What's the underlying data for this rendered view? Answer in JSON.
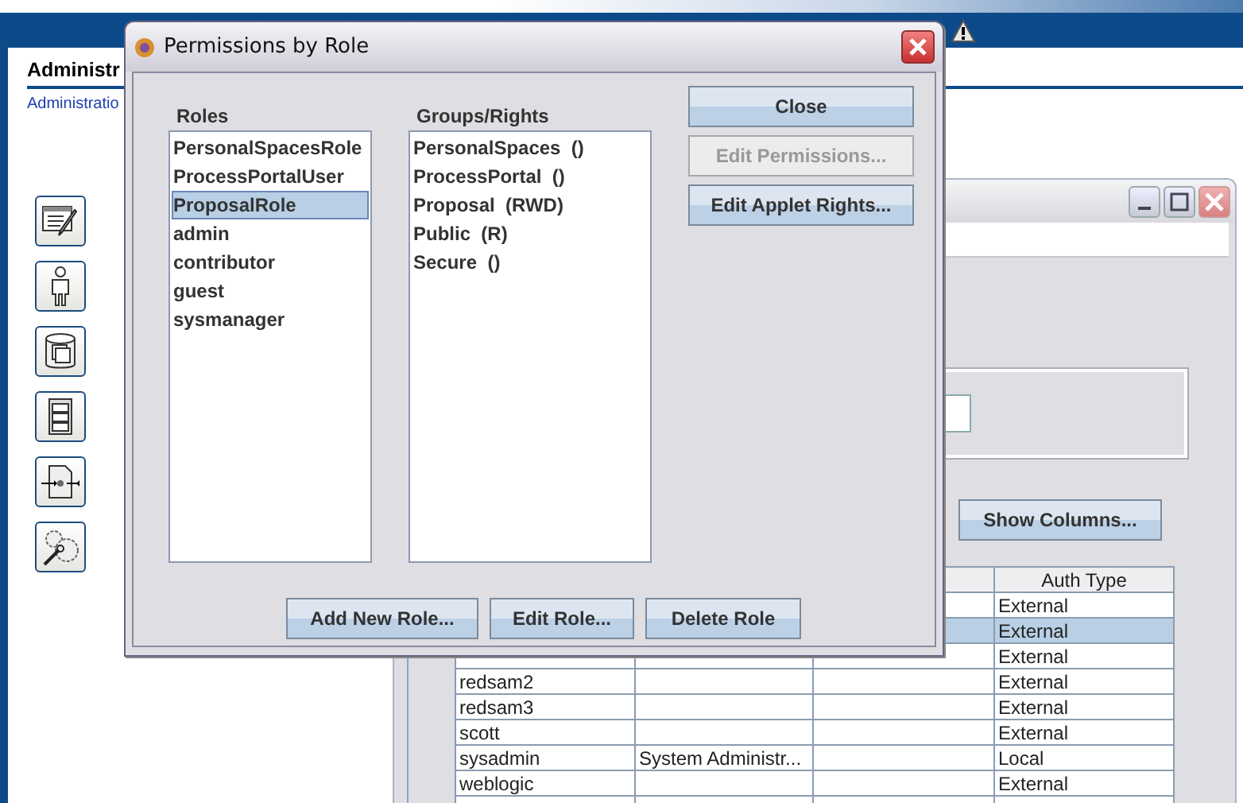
{
  "admin_panel": {
    "heading": "Administr",
    "link": "Administratio"
  },
  "inner_window": {
    "show_columns_button": "Show Columns...",
    "table": {
      "columns": [
        "",
        "",
        "",
        "Auth Type"
      ],
      "rows": [
        {
          "auth_type": "External",
          "selected": false
        },
        {
          "auth_type": "External",
          "selected": true
        },
        {
          "auth_type": "External",
          "selected": false
        },
        {
          "user": "redsam2",
          "auth_type": "External",
          "selected": false
        },
        {
          "user": "redsam3",
          "auth_type": "External",
          "selected": false
        },
        {
          "user": "scott",
          "auth_type": "External",
          "selected": false
        },
        {
          "user": "sysadmin",
          "description": "System Administr...",
          "auth_type": "Local",
          "selected": false
        },
        {
          "user": "weblogic",
          "auth_type": "External",
          "selected": false
        }
      ]
    }
  },
  "dialog": {
    "title": "Permissions by Role",
    "roles_label": "Roles",
    "groups_label": "Groups/Rights",
    "roles": [
      {
        "label": "PersonalSpacesRole",
        "selected": false
      },
      {
        "label": "ProcessPortalUser",
        "selected": false
      },
      {
        "label": "ProposalRole",
        "selected": true
      },
      {
        "label": "admin",
        "selected": false
      },
      {
        "label": "contributor",
        "selected": false
      },
      {
        "label": "guest",
        "selected": false
      },
      {
        "label": "sysmanager",
        "selected": false
      }
    ],
    "groups": [
      "PersonalSpaces  ()",
      "ProcessPortal  ()",
      "Proposal  (RWD)",
      "Public  (R)",
      "Secure  ()"
    ],
    "side_buttons": [
      {
        "label": "Close",
        "disabled": false
      },
      {
        "label": "Edit Permissions...",
        "disabled": true
      },
      {
        "label": "Edit Applet Rights...",
        "disabled": false
      }
    ],
    "bottom_buttons": [
      {
        "label": "Add New Role...",
        "disabled": false
      },
      {
        "label": "Edit Role...",
        "disabled": false
      },
      {
        "label": "Delete Role",
        "disabled": false
      }
    ]
  }
}
